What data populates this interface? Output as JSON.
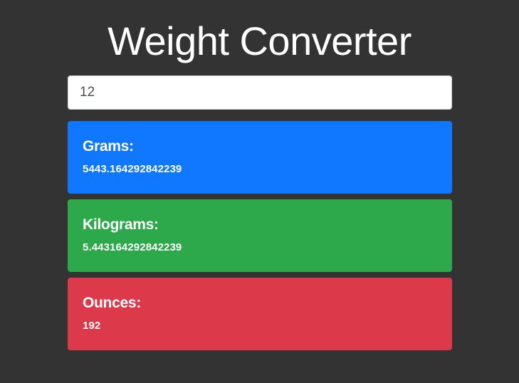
{
  "app": {
    "title": "Weight Converter"
  },
  "input": {
    "value": "12"
  },
  "results": [
    {
      "label": "Grams:",
      "value": "5443.164292842239",
      "color": "#0f78ff"
    },
    {
      "label": "Kilograms:",
      "value": "5.443164292842239",
      "color": "#2da84a"
    },
    {
      "label": "Ounces:",
      "value": "192",
      "color": "#dc3a4a"
    }
  ],
  "colors": {
    "background": "#333333",
    "input_background": "#ffffff",
    "text": "#ffffff"
  }
}
